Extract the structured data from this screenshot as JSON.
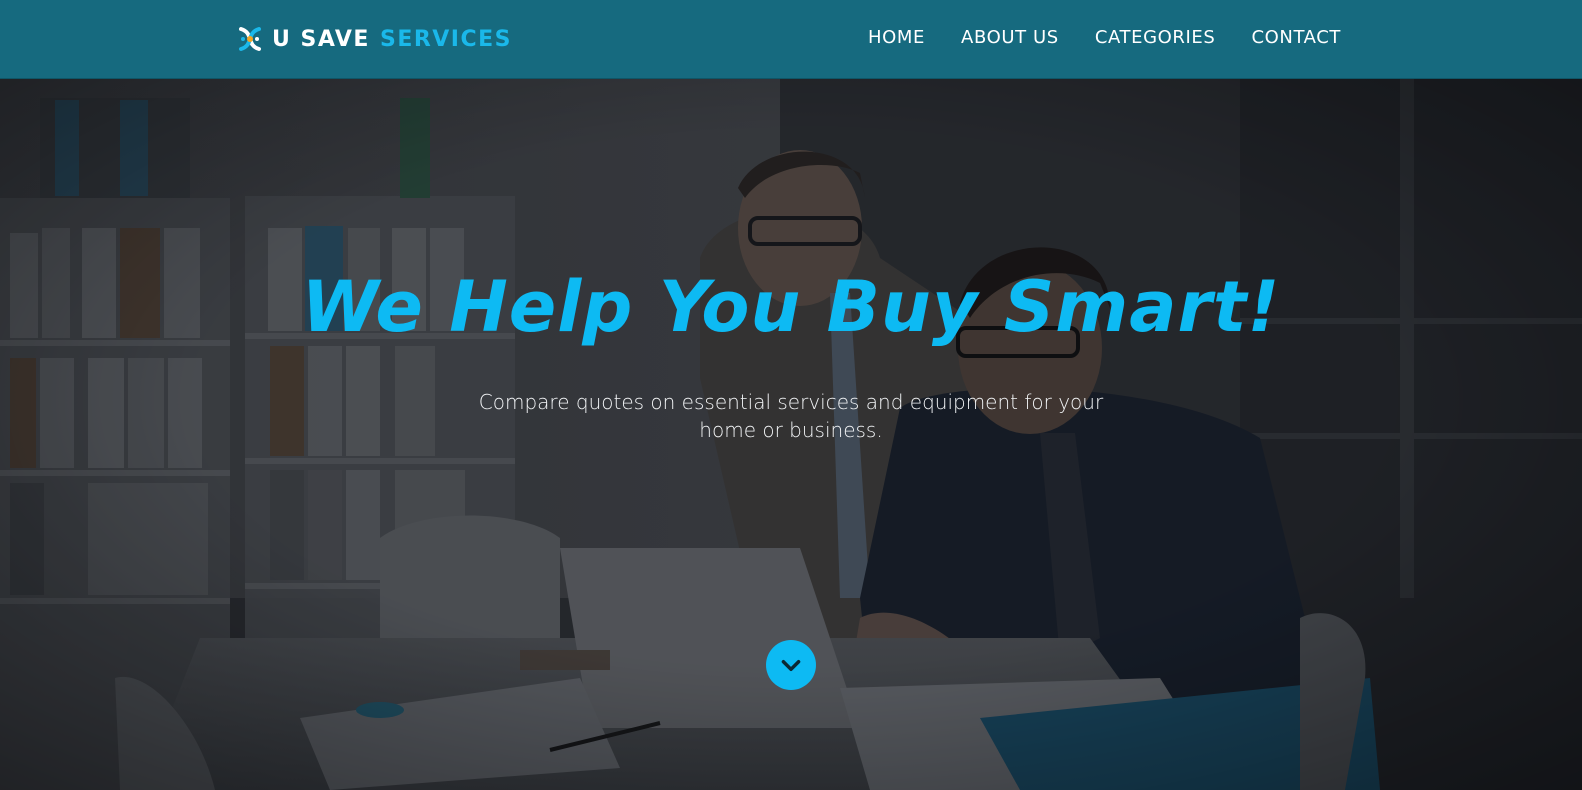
{
  "brand": {
    "name_part1": "U SAVE",
    "name_part2": "SERVICES",
    "accent_color": "#0dbaf3",
    "header_color": "#166a7f",
    "logo_icon": "dna-ribbon-logo-icon"
  },
  "nav": {
    "items": [
      {
        "label": "HOME"
      },
      {
        "label": "ABOUT US"
      },
      {
        "label": "CATEGORIES"
      },
      {
        "label": "CONTACT"
      }
    ]
  },
  "hero": {
    "title": "We Help You Buy Smart!",
    "subtitle": "Compare quotes on essential services and equipment for your home or business.",
    "scroll_icon": "chevron-down-icon"
  }
}
